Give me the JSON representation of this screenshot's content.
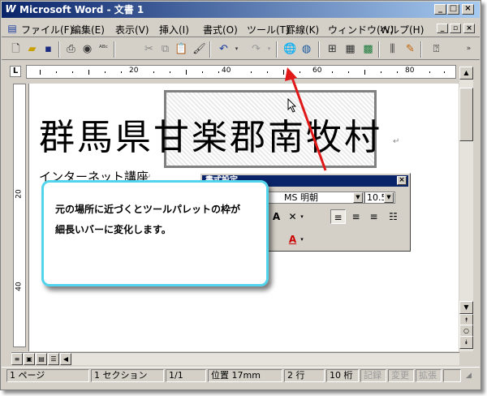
{
  "window": {
    "title": "Microsoft Word - 文書 1",
    "app_icon": "word-app-icon",
    "caption_buttons": [
      "minimize",
      "maximize",
      "close"
    ]
  },
  "menubar": {
    "items": [
      "ファイル(F)",
      "編集(E)",
      "表示(V)",
      "挿入(I)",
      "書式(O)",
      "ツール(T)",
      "罫線(K)",
      "ウィンドウ(W)",
      "ヘルプ(H)"
    ]
  },
  "toolbar": {
    "icons": [
      "new-icon",
      "open-icon",
      "save-icon",
      "print-icon",
      "print-preview-icon",
      "spelling-icon",
      "cut-icon",
      "copy-icon",
      "paste-icon",
      "format-painter-icon",
      "undo-icon",
      "redo-icon",
      "hyperlink-icon",
      "web-toolbar-icon",
      "tables-borders-icon",
      "insert-table-icon",
      "insert-excel-icon",
      "columns-icon",
      "drawing-icon",
      "office-assistant-icon"
    ]
  },
  "ruler": {
    "corner_label": "L",
    "marks": [
      "20",
      "40",
      "60",
      "80"
    ]
  },
  "vruler": {
    "marks": [
      "20",
      "40"
    ]
  },
  "document": {
    "line1": "群馬県甘楽郡南牧村",
    "line2": "インターネット講座",
    "return_mark": "↵"
  },
  "palette": {
    "title": "書式設定",
    "font": "MS 明朝",
    "size": "10.5"
  },
  "callout": {
    "line1": "元の場所に近づくとツールパレットの枠が",
    "line2": "細長いバーに変化します。"
  },
  "statusbar": {
    "page": "1 ページ",
    "section": "1 セクション",
    "pages": "1/1",
    "position": "位置 17mm",
    "line": "2 行",
    "column": "10 桁",
    "rec": "記録",
    "trk": "変更",
    "ext": "拡張"
  },
  "colors": {
    "title_bar": "#0a246a",
    "callout_border": "#52d4ec",
    "arrow": "#e01818",
    "font_color_a": "#cc0000"
  }
}
